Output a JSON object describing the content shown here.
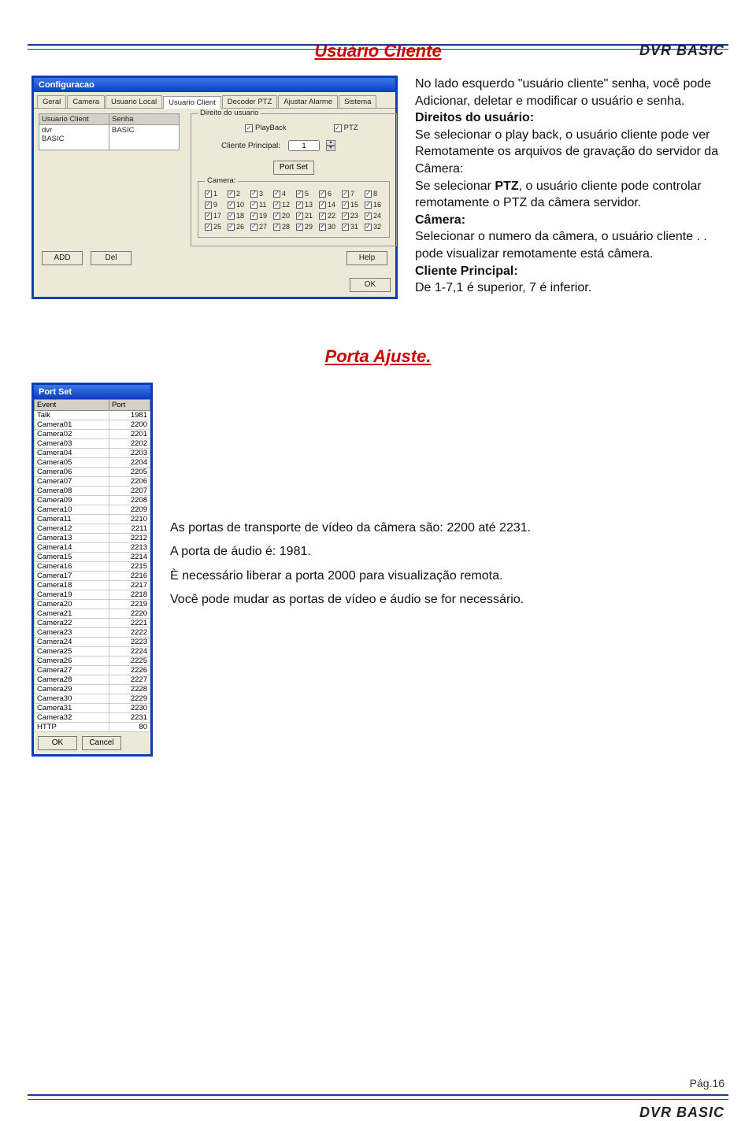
{
  "header": {
    "brand": "DVR BASIC"
  },
  "footer": {
    "brand": "DVR BASIC",
    "page": "Pág.16"
  },
  "section1": {
    "title": "Usuário Cliente",
    "window": {
      "title": "Configuracao",
      "tabs": [
        "Geral",
        "Camera",
        "Usuario Local",
        "Usuario Client",
        "Decoder PTZ",
        "Ajustar Alarme",
        "Sistema"
      ],
      "active_tab": "Usuario Client",
      "list": {
        "col1_header": "Usuario Client",
        "col2_header": "Senha",
        "col1_value": "dvr",
        "col2_value": "",
        "row2_col1": "BASIC",
        "row2_col2": "BASIC"
      },
      "rights": {
        "legend": "Direito do usuario",
        "playback": "PlayBack",
        "ptz": "PTZ",
        "client_principal_label": "Cliente Principal:",
        "client_principal_value": "1",
        "portset_btn": "Port Set"
      },
      "camera": {
        "legend": "Camera:",
        "items": [
          "1",
          "2",
          "3",
          "4",
          "5",
          "6",
          "7",
          "8",
          "9",
          "10",
          "11",
          "12",
          "13",
          "14",
          "15",
          "16",
          "17",
          "18",
          "19",
          "20",
          "21",
          "22",
          "23",
          "24",
          "25",
          "26",
          "27",
          "28",
          "29",
          "30",
          "31",
          "32"
        ]
      },
      "buttons": {
        "add": "ADD",
        "del": "Del",
        "help": "Help",
        "ok": "OK"
      }
    },
    "desc": {
      "p1": "No lado esquerdo \"usuário cliente\" senha, você pode Adicionar, deletar e modificar o usuário e senha.",
      "h1": "Direitos do usuário:",
      "p2a": "Se selecionar o play back, o usuário cliente pode ver Remotamente os arquivos de gravação do servidor da Câmera:",
      "p2b": "Se selecionar ",
      "ptz": "PTZ",
      "p2c": ", o usuário cliente pode controlar remotamente o PTZ da câmera servidor.",
      "h2": "Câmera:",
      "p3": "Selecionar o numero da câmera, o usuário cliente .      . pode visualizar remotamente está câmera.",
      "h3": "Cliente Principal:",
      "p4": "De 1-7,1 é superior, 7 é inferior."
    }
  },
  "section2": {
    "title": "Porta Ajuste.",
    "window": {
      "title": "Port Set",
      "col1": "Event",
      "col2": "Port",
      "rows": [
        {
          "e": "Talk",
          "p": "1981"
        },
        {
          "e": "Camera01",
          "p": "2200"
        },
        {
          "e": "Camera02",
          "p": "2201"
        },
        {
          "e": "Camera03",
          "p": "2202"
        },
        {
          "e": "Camera04",
          "p": "2203"
        },
        {
          "e": "Camera05",
          "p": "2204"
        },
        {
          "e": "Camera06",
          "p": "2205"
        },
        {
          "e": "Camera07",
          "p": "2206"
        },
        {
          "e": "Camera08",
          "p": "2207"
        },
        {
          "e": "Camera09",
          "p": "2208"
        },
        {
          "e": "Camera10",
          "p": "2209"
        },
        {
          "e": "Camera11",
          "p": "2210"
        },
        {
          "e": "Camera12",
          "p": "2211"
        },
        {
          "e": "Camera13",
          "p": "2212"
        },
        {
          "e": "Camera14",
          "p": "2213"
        },
        {
          "e": "Camera15",
          "p": "2214"
        },
        {
          "e": "Camera16",
          "p": "2215"
        },
        {
          "e": "Camera17",
          "p": "2216"
        },
        {
          "e": "Camera18",
          "p": "2217"
        },
        {
          "e": "Camera19",
          "p": "2218"
        },
        {
          "e": "Camera20",
          "p": "2219"
        },
        {
          "e": "Camera21",
          "p": "2220"
        },
        {
          "e": "Camera22",
          "p": "2221"
        },
        {
          "e": "Camera23",
          "p": "2222"
        },
        {
          "e": "Camera24",
          "p": "2223"
        },
        {
          "e": "Camera25",
          "p": "2224"
        },
        {
          "e": "Camera26",
          "p": "2225"
        },
        {
          "e": "Camera27",
          "p": "2226"
        },
        {
          "e": "Camera28",
          "p": "2227"
        },
        {
          "e": "Camera29",
          "p": "2228"
        },
        {
          "e": "Camera30",
          "p": "2229"
        },
        {
          "e": "Camera31",
          "p": "2230"
        },
        {
          "e": "Camera32",
          "p": "2231"
        },
        {
          "e": "HTTP",
          "p": "80"
        }
      ],
      "ok": "OK",
      "cancel": "Cancel"
    },
    "desc": {
      "p1": "As portas de transporte de vídeo da câmera são: 2200 até 2231.",
      "p2": "A porta de áudio é: 1981.",
      "p3": "È necessário liberar a porta 2000 para visualização remota.",
      "p4": "Você pode mudar as portas de vídeo e áudio se for necessário."
    }
  }
}
